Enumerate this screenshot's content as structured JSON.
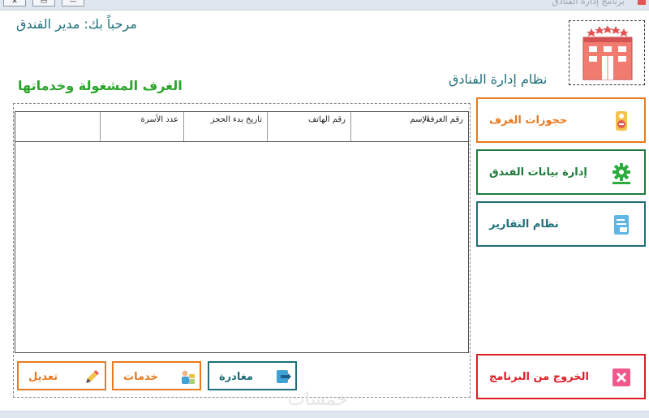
{
  "window": {
    "title": "برنامج إدارة الفنادق",
    "controls": [
      "✕",
      "▭",
      "—"
    ]
  },
  "header": {
    "welcome": "مرحباً بك: مدير الفندق",
    "section_title": "الغرف المشغولة وخدماتها",
    "system_title": "نظام إدارة الفنادق",
    "logo_icon": "hotel-building-icon"
  },
  "table": {
    "columns": [
      "رقم الغرفة",
      "الإسم",
      "رقم الهاتف",
      "تاريخ بدء الحجز",
      "عدد الأسرة"
    ],
    "rows": []
  },
  "bottom_buttons": {
    "leave": {
      "label": "مغادرة",
      "icon": "exit-door-icon",
      "color": "#1e6f7a"
    },
    "services": {
      "label": "خدمات",
      "icon": "room-service-icon",
      "color": "#e87a1f"
    },
    "edit": {
      "label": "تعديل",
      "icon": "pencil-icon",
      "color": "#e87a1f"
    }
  },
  "side_buttons": {
    "bookings": {
      "label": "حجوزات الغرف",
      "icon": "door-hanger-icon",
      "color": "#e87a1f"
    },
    "hotel_data": {
      "label": "إدارة بيانات الفندق",
      "icon": "gear-icon",
      "color": "#1e7a3a"
    },
    "reports": {
      "label": "نظام التقارير",
      "icon": "report-document-icon",
      "color": "#1e6f7a"
    },
    "exit": {
      "label": "الخروج من البرنامج",
      "icon": "close-icon",
      "color": "#e01b24"
    }
  },
  "watermark": "خمسات"
}
